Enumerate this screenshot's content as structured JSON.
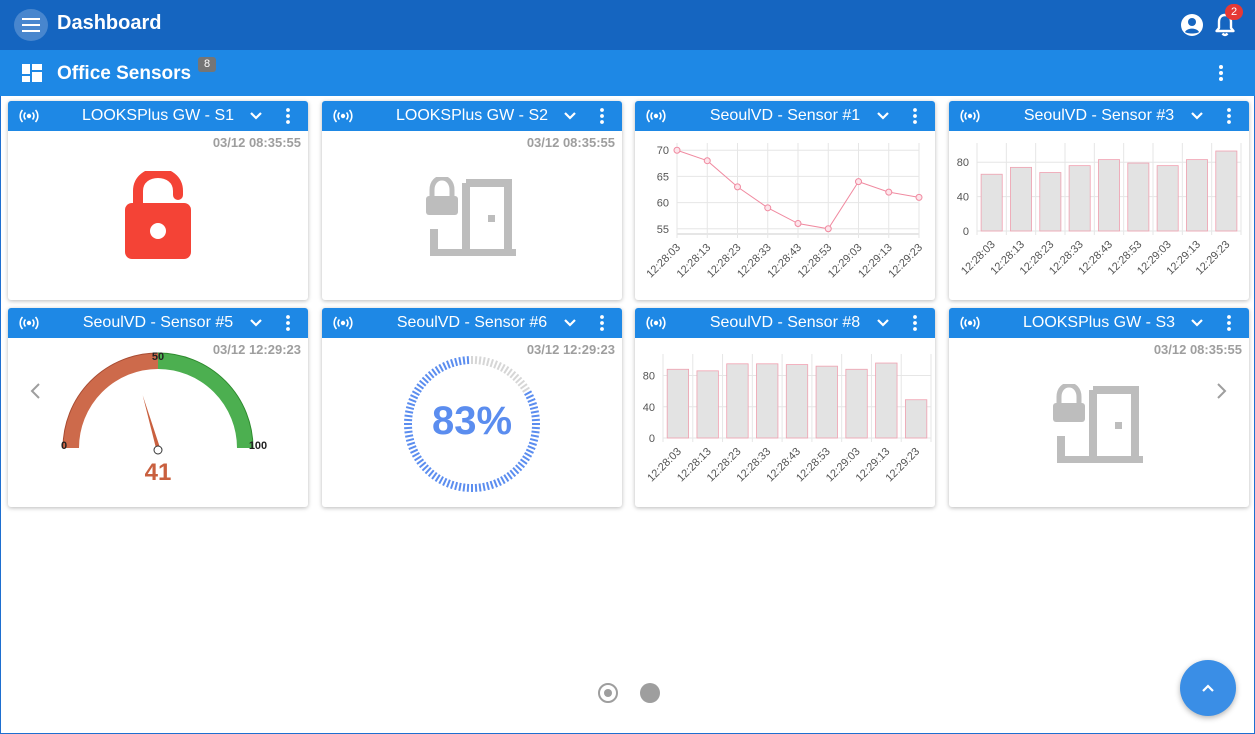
{
  "app": {
    "title": "Dashboard",
    "notification_count": "2",
    "icons": {
      "menu": "menu-icon",
      "account": "account-circle-icon",
      "bell": "bell-icon"
    }
  },
  "group": {
    "title": "Office Sensors",
    "count": "8",
    "icon": "dashboard-icon"
  },
  "colors": {
    "appbar": "#1565c0",
    "subbar": "#1e88e5",
    "lock_alert": "#f44336",
    "door_grey": "#bdbdbd",
    "gauge_low": "#cd6a4b",
    "gauge_high": "#4caf50",
    "progress": "#5b8def",
    "series_line": "#f08aa0",
    "bar_fill": "#e3e3e3",
    "bar_stroke": "#f0a0b0"
  },
  "cards": [
    {
      "title": "LOOKSPlus GW - S1",
      "timestamp": "03/12 08:35:55",
      "widget": "lock-open",
      "icon": "lock-open-icon"
    },
    {
      "title": "LOOKSPlus GW - S2",
      "timestamp": "03/12 08:35:55",
      "widget": "door-locked",
      "icon": "door-lock-icon"
    },
    {
      "title": "SeoulVD - Sensor #1",
      "widget": "line-chart"
    },
    {
      "title": "SeoulVD - Sensor #3",
      "widget": "bar-chart"
    },
    {
      "title": "SeoulVD - Sensor #5",
      "timestamp": "03/12 12:29:23",
      "widget": "gauge",
      "gauge": {
        "min": "0",
        "mid": "50",
        "max": "100",
        "value": "41"
      }
    },
    {
      "title": "SeoulVD - Sensor #6",
      "timestamp": "03/12 12:29:23",
      "widget": "progress-ring",
      "progress": {
        "value": 83,
        "label": "83%"
      }
    },
    {
      "title": "SeoulVD - Sensor #8",
      "widget": "bar-chart"
    },
    {
      "title": "LOOKSPlus GW - S3",
      "timestamp": "03/12 08:35:55",
      "widget": "door-locked",
      "icon": "door-lock-icon"
    }
  ],
  "chart_data": [
    {
      "type": "line",
      "x": [
        "12:28:03",
        "12:28:13",
        "12:28:23",
        "12:28:33",
        "12:28:43",
        "12:28:53",
        "12:29:03",
        "12:29:13",
        "12:29:23"
      ],
      "values": [
        70,
        68,
        63,
        59,
        56,
        55,
        64,
        62,
        61
      ],
      "ylim": [
        54,
        71
      ],
      "yticks": [
        "55",
        "60",
        "65",
        "70"
      ],
      "grid": true
    },
    {
      "type": "bar",
      "categories": [
        "12:28:03",
        "12:28:13",
        "12:28:23",
        "12:28:33",
        "12:28:43",
        "12:28:53",
        "12:29:03",
        "12:29:13",
        "12:29:23"
      ],
      "values": [
        66,
        74,
        68,
        76,
        83,
        79,
        76,
        83,
        93
      ],
      "ylim": [
        0,
        100
      ],
      "yticks": [
        "0",
        "40",
        "80"
      ],
      "grid": true
    },
    {
      "type": "bar",
      "categories": [
        "12:28:03",
        "12:28:13",
        "12:28:23",
        "12:28:33",
        "12:28:43",
        "12:28:53",
        "12:29:03",
        "12:29:13",
        "12:29:23"
      ],
      "values": [
        88,
        86,
        95,
        95,
        94,
        92,
        88,
        96,
        49
      ],
      "ylim": [
        0,
        105
      ],
      "yticks": [
        "0",
        "40",
        "80"
      ],
      "grid": true
    }
  ],
  "pager": {
    "pages": 2,
    "current": 1
  },
  "nav": {
    "left": "chevron-left-icon",
    "right": "chevron-right-icon",
    "scroll_top": "chevron-up-icon"
  }
}
